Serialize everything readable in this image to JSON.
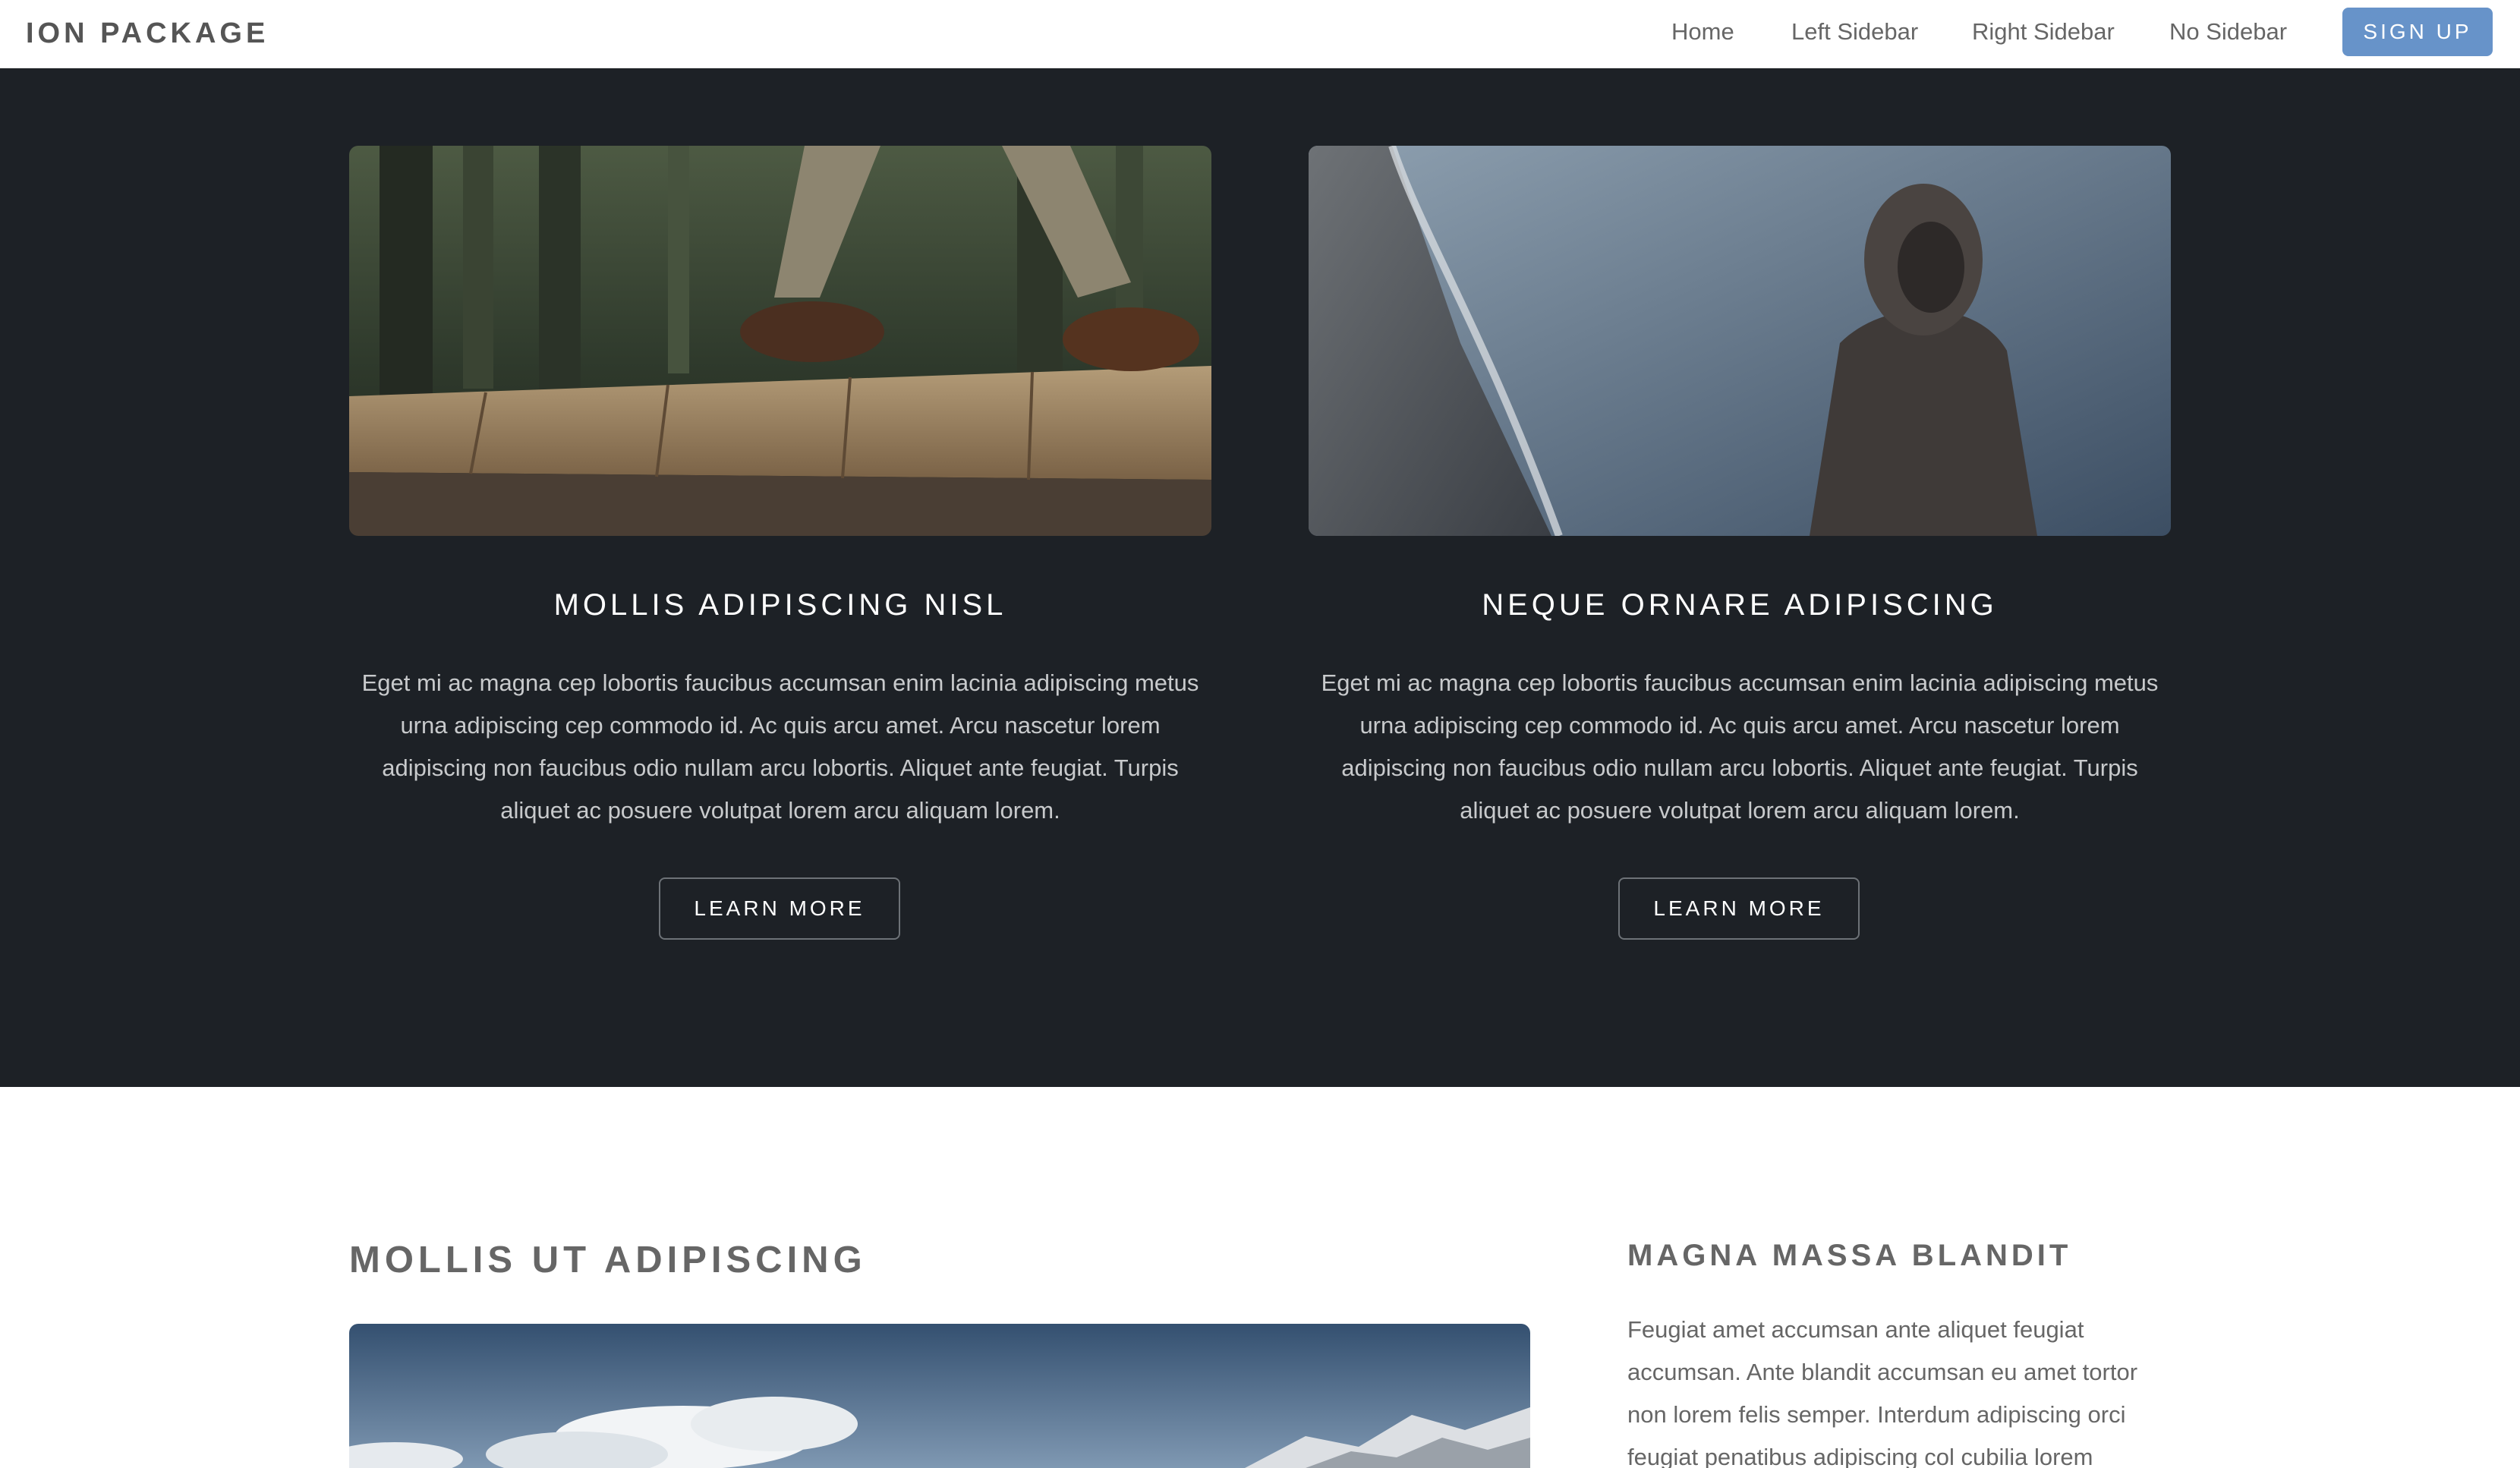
{
  "nav": {
    "brand": "ION PACKAGE",
    "links": [
      "Home",
      "Left Sidebar",
      "Right Sidebar",
      "No Sidebar"
    ],
    "signup_label": "SIGN UP"
  },
  "features": [
    {
      "title": "MOLLIS ADIPISCING NISL",
      "lines": [
        "Eget mi ac magna cep lobortis faucibus accumsan enim lacinia adipiscing metus",
        "urna adipiscing cep commodo id. Ac quis arcu amet. Arcu nascetur lorem",
        "adipiscing non faucibus odio nullam arcu lobortis. Aliquet ante feugiat. Turpis",
        "aliquet ac posuere volutpat lorem arcu aliquam lorem."
      ],
      "button_label": "LEARN MORE"
    },
    {
      "title": "NEQUE ORNARE ADIPISCING",
      "lines": [
        "Eget mi ac magna cep lobortis faucibus accumsan enim lacinia adipiscing metus",
        "urna adipiscing cep commodo id. Ac quis arcu amet. Arcu nascetur lorem",
        "adipiscing non faucibus odio nullam arcu lobortis. Aliquet ante feugiat. Turpis",
        "aliquet ac posuere volutpat lorem arcu aliquam lorem."
      ],
      "button_label": "LEARN MORE"
    }
  ],
  "main": {
    "title": "MOLLIS UT ADIPISCING"
  },
  "sidebar": {
    "title": "MAGNA MASSA BLANDIT",
    "lines": [
      "Feugiat amet accumsan ante aliquet feugiat",
      "accumsan. Ante blandit accumsan eu amet tortor",
      "non lorem felis semper. Interdum adipiscing orci",
      "feugiat penatibus adipiscing col cubilia lorem"
    ]
  },
  "colors": {
    "accent": "#6793c9",
    "band_background": "#1d2126"
  }
}
